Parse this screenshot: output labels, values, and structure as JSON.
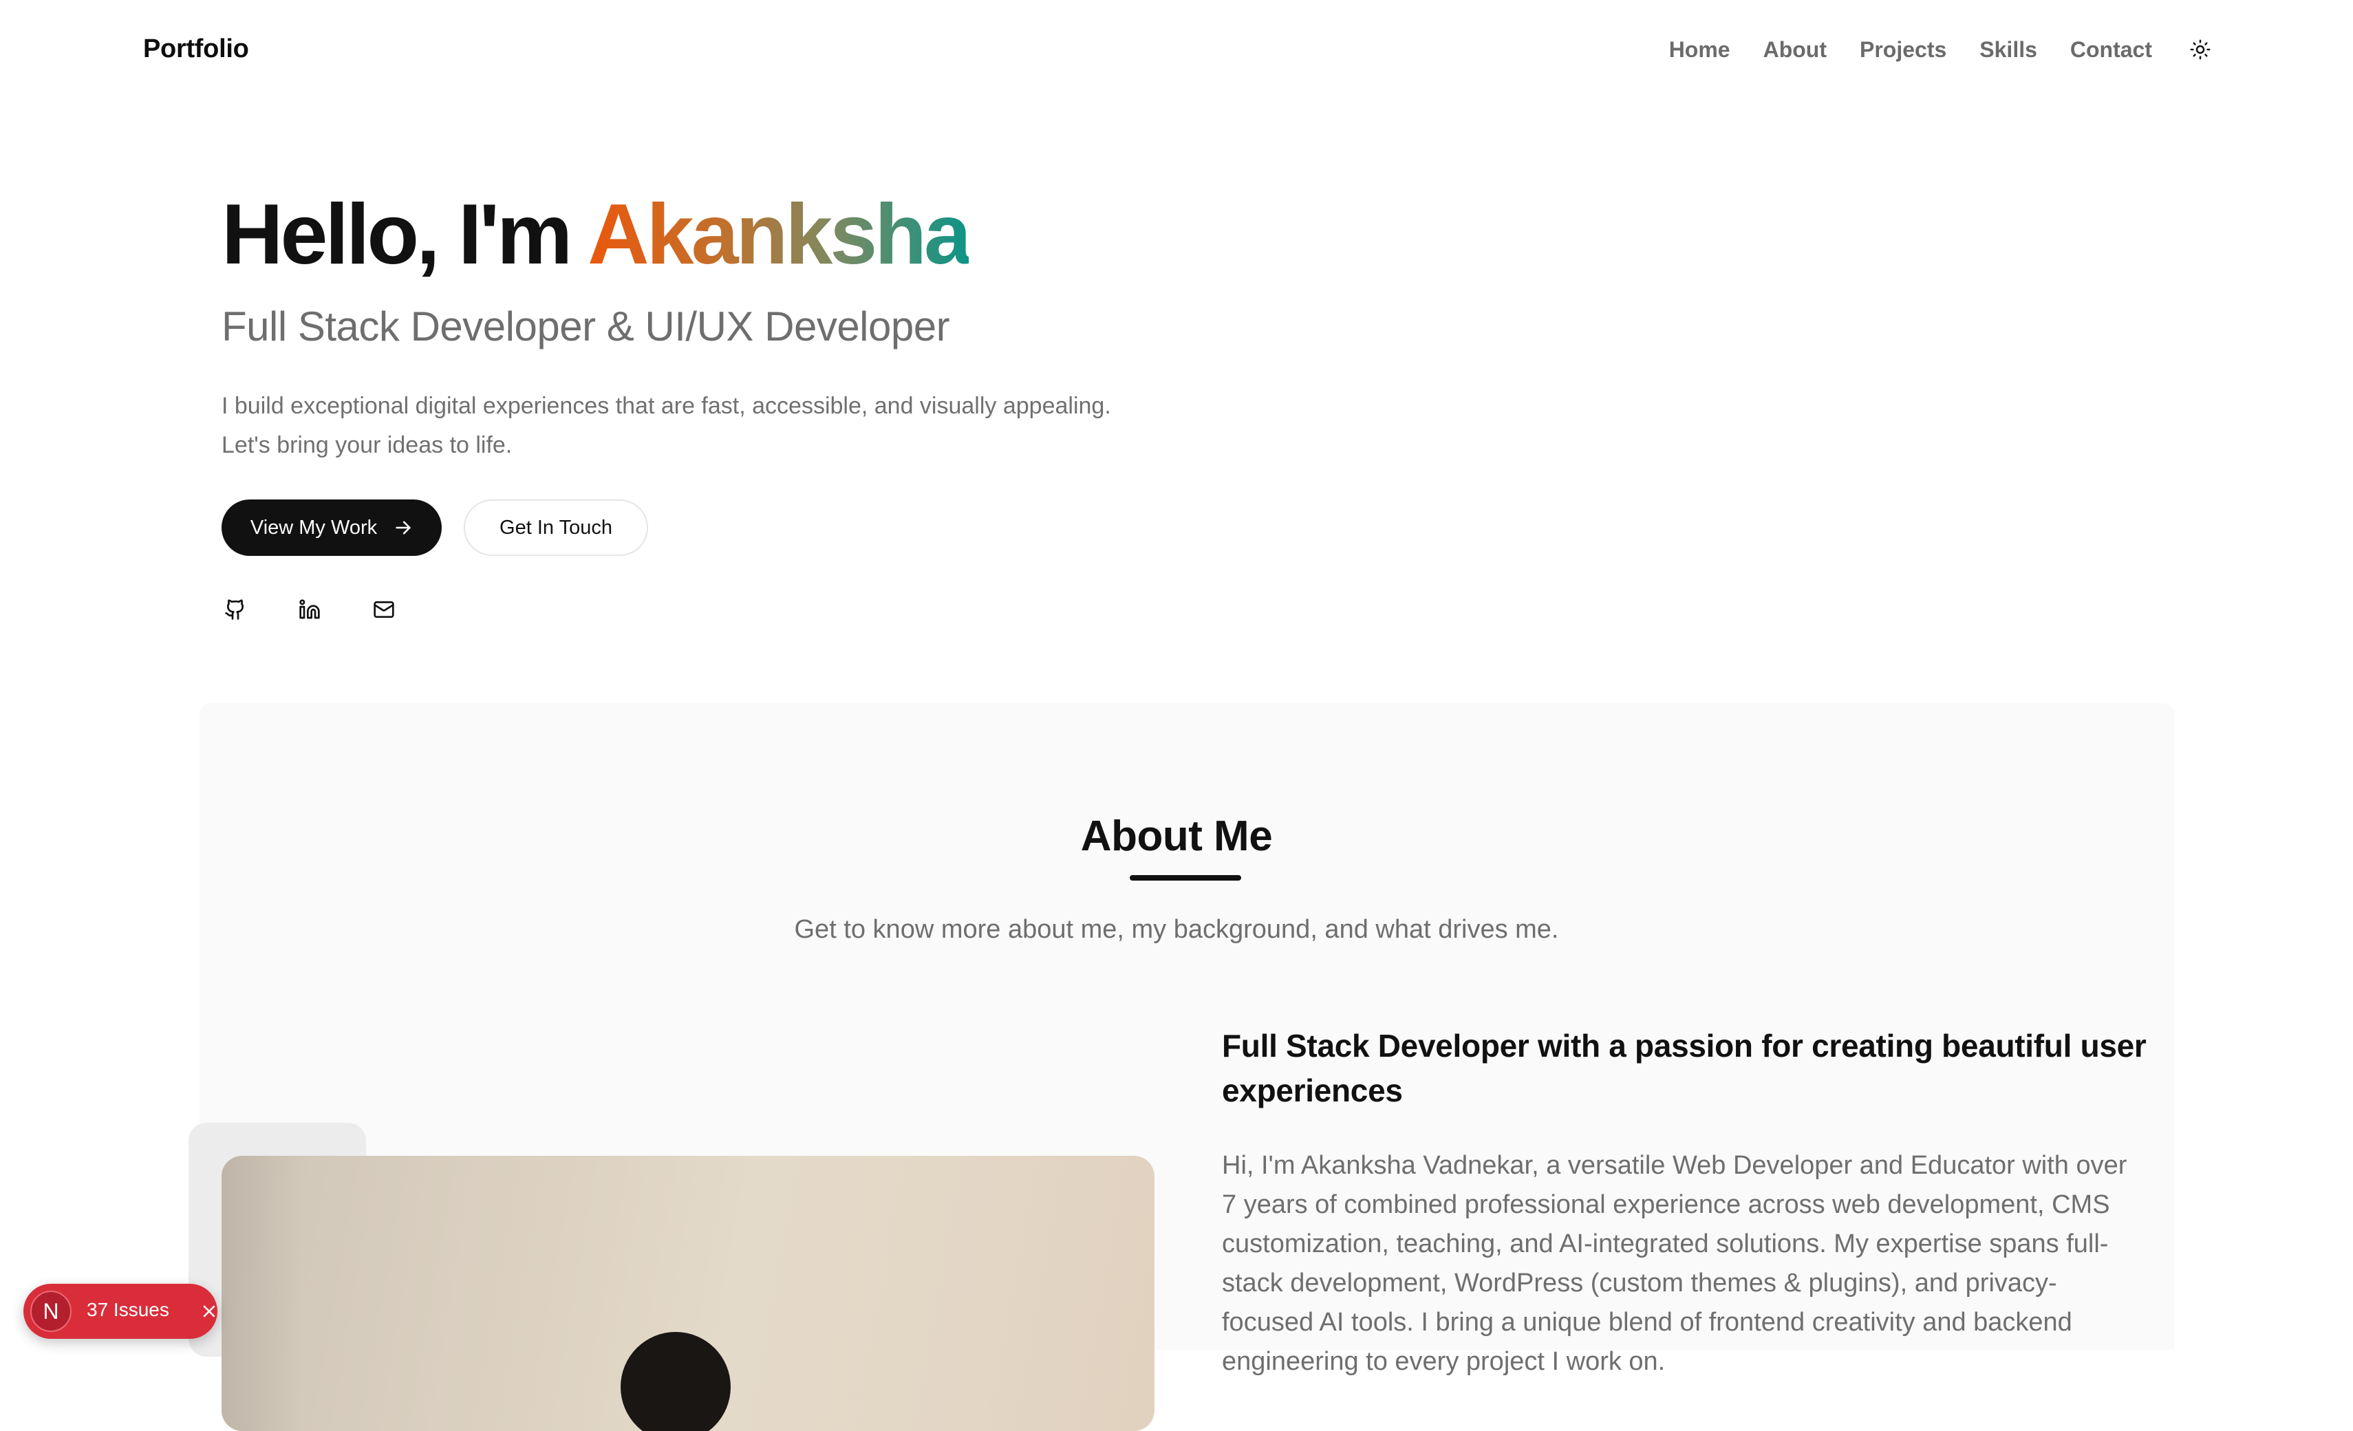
{
  "nav": {
    "brand": "Portfolio",
    "links": [
      "Home",
      "About",
      "Projects",
      "Skills",
      "Contact"
    ],
    "theme_toggle_icon": "sun-icon"
  },
  "hero": {
    "greeting": "Hello, I'm ",
    "name": "Akanksha",
    "subtitle": "Full Stack Developer & UI/UX Developer",
    "description": "I build exceptional digital experiences that are fast, accessible, and visually appealing. Let's bring your ideas to life.",
    "primary_button": "View My Work",
    "secondary_button": "Get In Touch",
    "socials": [
      "github-icon",
      "linkedin-icon",
      "mail-icon"
    ],
    "name_gradient": [
      "#ea580c",
      "#0d9488"
    ]
  },
  "about": {
    "title": "About Me",
    "subtitle": "Get to know more about me, my background, and what drives me.",
    "heading": "Full Stack Developer with a passion for creating beautiful user experiences",
    "paragraph": "Hi, I'm Akanksha Vadnekar, a versatile Web Developer and Educator with over 7 years of combined professional experience across web development, CMS customization, teaching, and AI-integrated solutions. My expertise spans full-stack development, WordPress (custom themes & plugins), and privacy-focused AI tools. I bring a unique blend of frontend creativity and backend engineering to every project I work on."
  },
  "dev_overlay": {
    "logo_letter": "N",
    "issues_label": "37 Issues",
    "color": "#d92d3a"
  }
}
